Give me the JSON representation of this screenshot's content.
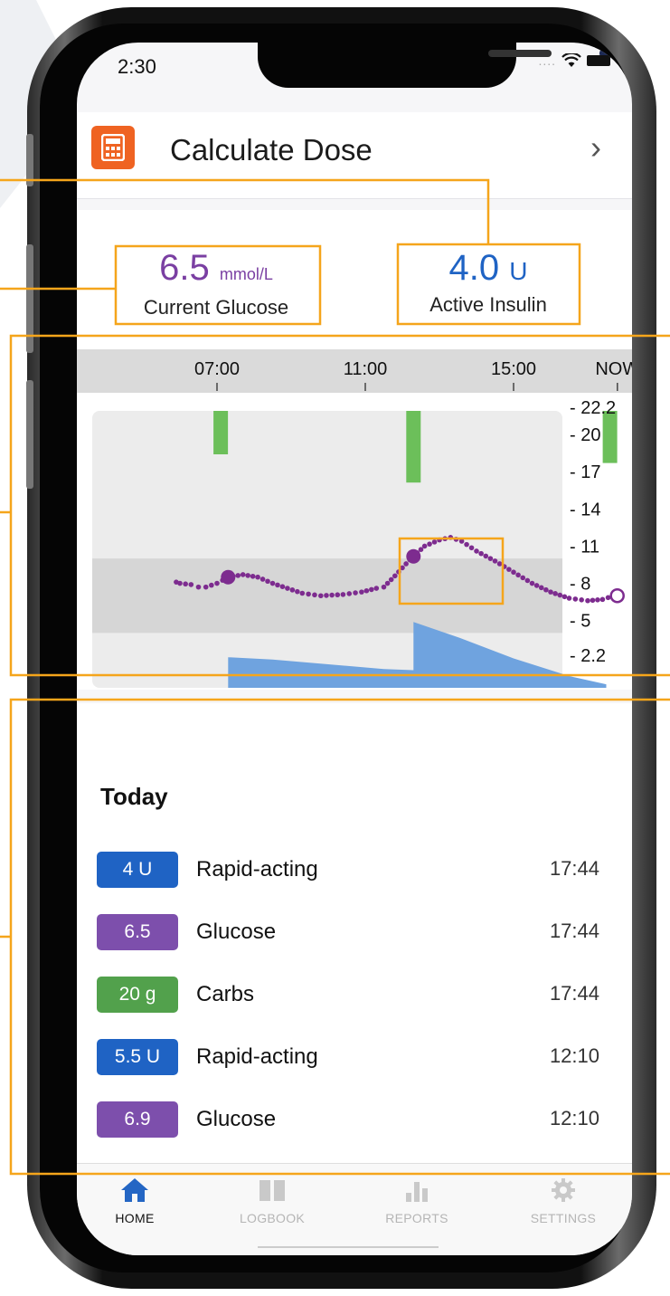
{
  "status_bar": {
    "time": "2:30"
  },
  "dose_card": {
    "title": "Calculate Dose",
    "chevron": "›",
    "icon": "calculator-icon"
  },
  "stats": {
    "glucose": {
      "value": "6.5",
      "unit": "mmol/L",
      "label": "Current Glucose"
    },
    "insulin": {
      "value": "4.0",
      "unit": "U",
      "label": "Active Insulin"
    }
  },
  "chart_data": {
    "type": "line",
    "x_ticks": [
      "07:00",
      "11:00",
      "15:00",
      "NOW"
    ],
    "y_ticks": [
      "22.2",
      "20",
      "17",
      "14",
      "11",
      "8",
      "5",
      "2.2"
    ],
    "target_range": [
      4,
      10
    ],
    "series": [
      {
        "values": [
          [
            5.9,
            8.1
          ],
          [
            6.0,
            8.0
          ],
          [
            6.3,
            7.9
          ],
          [
            6.5,
            7.7
          ],
          [
            6.7,
            7.7
          ],
          [
            7.0,
            8.0
          ],
          [
            7.3,
            8.5
          ],
          [
            7.7,
            8.7
          ],
          [
            8.1,
            8.5
          ],
          [
            8.5,
            8.0
          ],
          [
            8.9,
            7.6
          ],
          [
            9.3,
            7.2
          ],
          [
            9.8,
            7.0
          ],
          [
            10.4,
            7.1
          ],
          [
            10.9,
            7.3
          ],
          [
            11.3,
            7.6
          ],
          [
            11.5,
            7.7
          ],
          [
            11.8,
            8.6
          ],
          [
            12.2,
            9.9
          ],
          [
            12.6,
            11.0
          ],
          [
            13.0,
            11.5
          ],
          [
            13.3,
            11.7
          ],
          [
            13.6,
            11.4
          ],
          [
            14.0,
            10.6
          ],
          [
            14.5,
            9.8
          ],
          [
            15.0,
            8.9
          ],
          [
            15.5,
            8.0
          ],
          [
            16.0,
            7.3
          ],
          [
            16.5,
            6.8
          ],
          [
            17.0,
            6.6
          ],
          [
            17.4,
            6.7
          ],
          [
            17.7,
            7.0
          ]
        ]
      }
    ],
    "carb_bars": [
      {
        "time": 7.1,
        "value": 20
      },
      {
        "time": 12.3,
        "value": 33
      },
      {
        "time": 17.6,
        "value": 24
      }
    ],
    "insulin_on_board": [
      [
        5.5,
        0
      ],
      [
        7.3,
        0
      ],
      [
        7.3,
        2.6
      ],
      [
        8.5,
        2.4
      ],
      [
        10.0,
        2.0
      ],
      [
        11.5,
        1.6
      ],
      [
        12.3,
        1.5
      ],
      [
        12.3,
        5.6
      ],
      [
        13.5,
        4.3
      ],
      [
        15.0,
        2.5
      ],
      [
        16.5,
        1.0
      ],
      [
        17.5,
        0.3
      ],
      [
        17.5,
        0
      ],
      [
        18.2,
        0
      ]
    ],
    "meal_markers": [
      7.3,
      12.3
    ]
  },
  "today": {
    "title": "Today",
    "rows": [
      {
        "badge": "4 U",
        "label": "Rapid-acting",
        "time": "17:44",
        "color": "#1f63c4"
      },
      {
        "badge": "6.5",
        "label": "Glucose",
        "time": "17:44",
        "color": "#7d4fac"
      },
      {
        "badge": "20 g",
        "label": "Carbs",
        "time": "17:44",
        "color": "#52a14c"
      },
      {
        "badge": "5.5 U",
        "label": "Rapid-acting",
        "time": "12:10",
        "color": "#1f63c4"
      },
      {
        "badge": "6.9",
        "label": "Glucose",
        "time": "12:10",
        "color": "#7d4fac"
      }
    ]
  },
  "tabs": [
    {
      "label": "HOME",
      "icon": "home-icon",
      "active": true
    },
    {
      "label": "LOGBOOK",
      "icon": "book-icon",
      "active": false
    },
    {
      "label": "REPORTS",
      "icon": "bar-chart-icon",
      "active": false
    },
    {
      "label": "SETTINGS",
      "icon": "gear-icon",
      "active": false
    }
  ],
  "colors": {
    "callout": "#f5a51b",
    "accent_orange": "#ef6322",
    "glucose": "#7a3fa2",
    "insulin": "#1f63c4"
  }
}
